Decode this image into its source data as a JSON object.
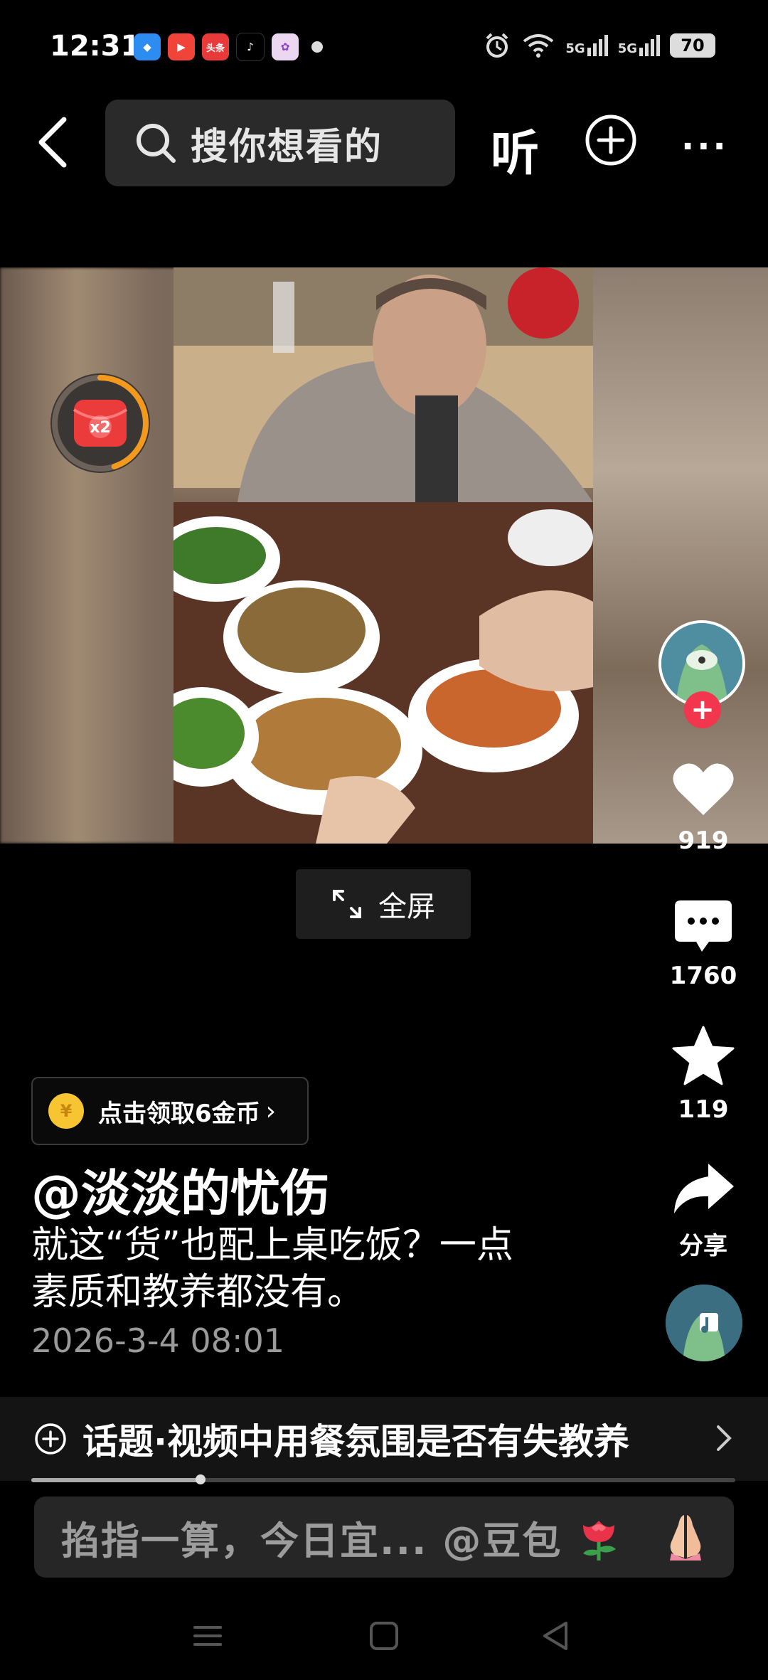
{
  "status_bar": {
    "time": "12:31",
    "signal_1": "5G",
    "signal_2": "5G",
    "battery": "70"
  },
  "top_nav": {
    "search_placeholder": "搜你想看的",
    "listen_label": "听",
    "more_label": "···"
  },
  "red_packet": {
    "multiplier": "x2",
    "progress": 0.45
  },
  "actions": {
    "likes": "919",
    "comments": "1760",
    "favorites": "119",
    "share_label": "分享"
  },
  "fullscreen": {
    "label": "全屏"
  },
  "coin_chip": {
    "coin_symbol": "¥",
    "label": "点击领取6金币",
    "chevron": "›"
  },
  "post": {
    "author": "@淡淡的忧伤",
    "description_line1": "就这“货”也配上桌吃饭？一点",
    "description_line2": "素质和教养都没有。",
    "date": "2026-3-4 08:01"
  },
  "topic": {
    "label": "话题·视频中用餐氛围是否有失教养"
  },
  "playback": {
    "progress": 0.24
  },
  "comment_input": {
    "placeholder": "掐指一算，今日宜... @豆包"
  },
  "colors": {
    "follow_red": "#f2364d",
    "coin_gold": "#f6c531",
    "redpack_orange": "#f39a1e"
  }
}
